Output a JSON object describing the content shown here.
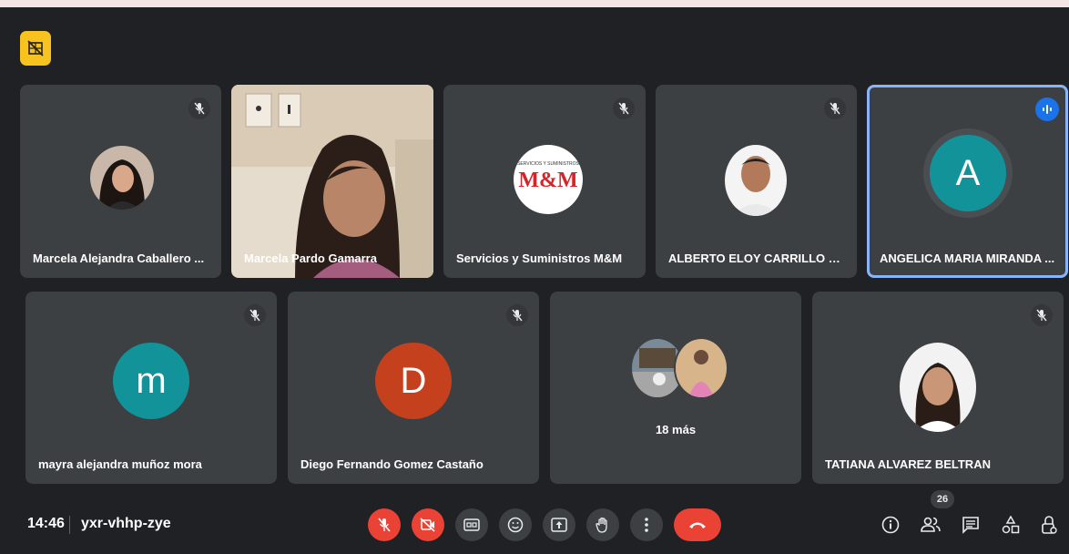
{
  "meeting": {
    "time": "14:46",
    "code": "yxr-vhhp-zye",
    "participants_count": "26"
  },
  "tiles": {
    "t1": {
      "name": "Marcela Alejandra Caballero ..."
    },
    "t2": {
      "name": "Marcela Pardo Gamarra"
    },
    "t3": {
      "name": "Servicios y Suministros M&M",
      "logo_text": "M&M",
      "logo_small": "SERVICIOS Y SUMINISTROS"
    },
    "t4": {
      "name": "ALBERTO ELOY CARRILLO VA..."
    },
    "t5": {
      "name": "ANGELICA MARIA MIRANDA ...",
      "initial": "A"
    },
    "t6": {
      "name": "mayra alejandra muñoz mora",
      "initial": "m"
    },
    "t7": {
      "name": "Diego Fernando Gomez Castaño",
      "initial": "D"
    },
    "t8": {
      "more_label": "18 más"
    },
    "t9": {
      "name": "TATIANA ALVAREZ BELTRAN"
    }
  },
  "colors": {
    "background": "#202124",
    "tile": "#3c4043",
    "accent_blue": "#8ab4f8",
    "red": "#ea4335",
    "teal_avatar": "#12939a",
    "orange_avatar": "#c5401c",
    "badge_yellow": "#f9c31f"
  },
  "icons": {
    "top_badge": "no-video-badge-icon",
    "tile_muted": "mic-off-icon",
    "speaking": "audio-level-icon",
    "controls": [
      "mic-off-icon",
      "video-off-icon",
      "captions-icon",
      "emoji-icon",
      "present-icon",
      "raise-hand-icon",
      "more-options-icon",
      "hang-up-icon"
    ],
    "right": [
      "info-icon",
      "people-icon",
      "chat-icon",
      "activities-icon",
      "host-controls-icon"
    ]
  }
}
